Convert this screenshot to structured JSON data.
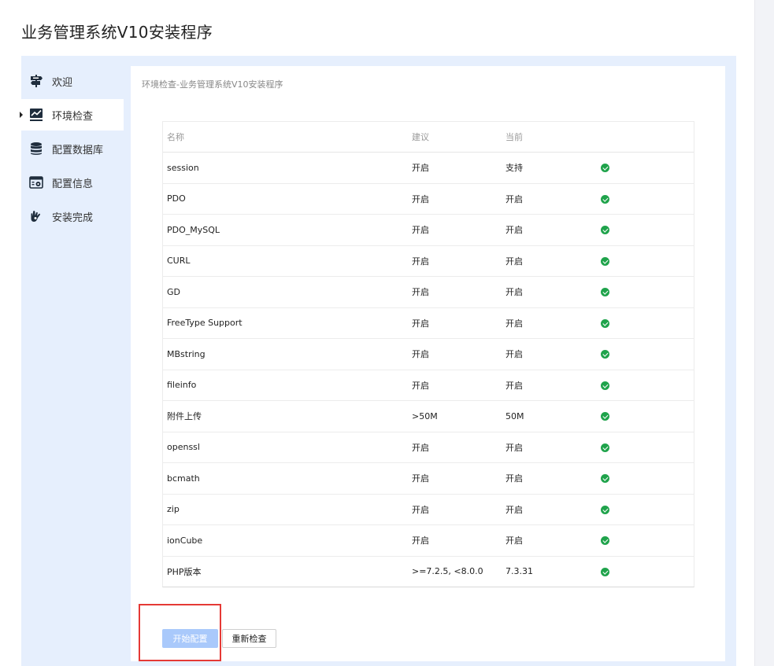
{
  "app": {
    "title": "业务管理系统V10安装程序"
  },
  "sidebar": {
    "items": [
      {
        "label": "欢迎",
        "icon": "signpost-icon",
        "active": false
      },
      {
        "label": "环境检查",
        "icon": "line-chart-icon",
        "active": true
      },
      {
        "label": "配置数据库",
        "icon": "database-icon",
        "active": false
      },
      {
        "label": "配置信息",
        "icon": "settings-window-icon",
        "active": false
      },
      {
        "label": "安装完成",
        "icon": "ok-hand-icon",
        "active": false
      }
    ]
  },
  "main": {
    "breadcrumb": "环境检查-业务管理系统V10安装程序",
    "table": {
      "headers": [
        "名称",
        "建议",
        "当前",
        ""
      ],
      "rows": [
        {
          "name": "session",
          "suggest": "开启",
          "current": "支持",
          "status": "ok"
        },
        {
          "name": "PDO",
          "suggest": "开启",
          "current": "开启",
          "status": "ok"
        },
        {
          "name": "PDO_MySQL",
          "suggest": "开启",
          "current": "开启",
          "status": "ok"
        },
        {
          "name": "CURL",
          "suggest": "开启",
          "current": "开启",
          "status": "ok"
        },
        {
          "name": "GD",
          "suggest": "开启",
          "current": "开启",
          "status": "ok"
        },
        {
          "name": "FreeType Support",
          "suggest": "开启",
          "current": "开启",
          "status": "ok"
        },
        {
          "name": "MBstring",
          "suggest": "开启",
          "current": "开启",
          "status": "ok"
        },
        {
          "name": "fileinfo",
          "suggest": "开启",
          "current": "开启",
          "status": "ok"
        },
        {
          "name": "附件上传",
          "suggest": ">50M",
          "current": "50M",
          "status": "ok"
        },
        {
          "name": "openssl",
          "suggest": "开启",
          "current": "开启",
          "status": "ok"
        },
        {
          "name": "bcmath",
          "suggest": "开启",
          "current": "开启",
          "status": "ok"
        },
        {
          "name": "zip",
          "suggest": "开启",
          "current": "开启",
          "status": "ok"
        },
        {
          "name": "ionCube",
          "suggest": "开启",
          "current": "开启",
          "status": "ok"
        },
        {
          "name": "PHP版本",
          "suggest": ">=7.2.5, <8.0.0",
          "current": "7.3.31",
          "status": "ok"
        }
      ]
    },
    "buttons": {
      "start_label": "开始配置",
      "recheck_label": "重新检查"
    }
  },
  "colors": {
    "panel_bg": "#e6effd",
    "primary_disabled": "#a9c9fb",
    "ok_green": "#1fa34b",
    "highlight_red": "#e53935"
  }
}
